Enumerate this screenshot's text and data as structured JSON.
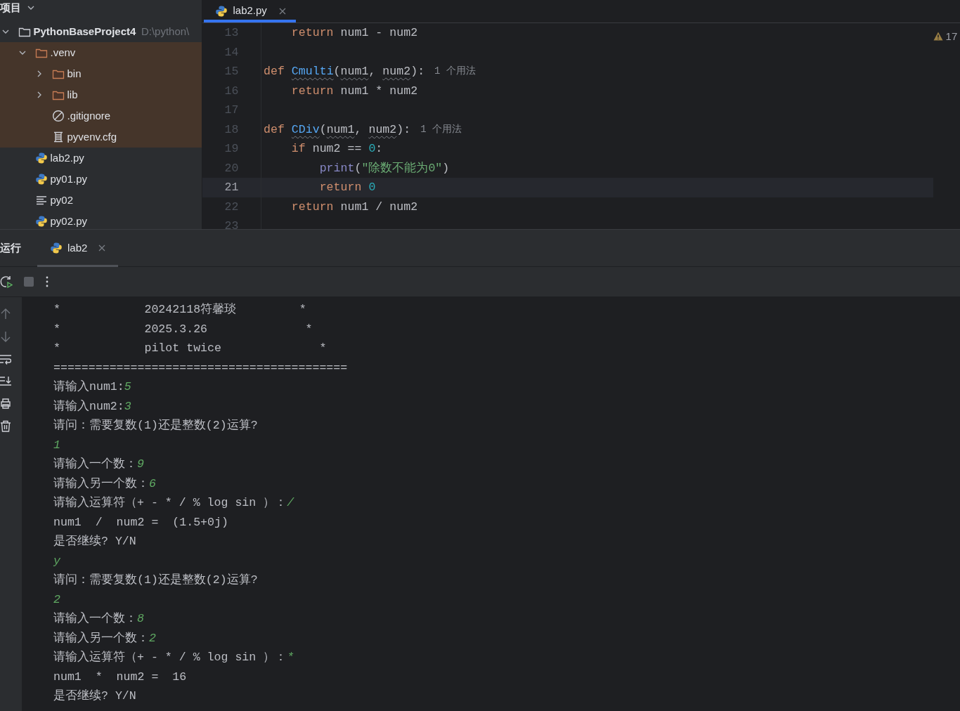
{
  "project_panel": {
    "title": "项目",
    "tree": [
      {
        "label": "PythonBaseProject4",
        "path": "D:\\python\\",
        "kind": "folder",
        "bold": true,
        "expanded": true,
        "children": [
          {
            "label": ".venv",
            "kind": "folder",
            "expanded": true,
            "excluded": true,
            "children": [
              {
                "label": "bin",
                "kind": "folder",
                "expanded": false
              },
              {
                "label": "lib",
                "kind": "folder",
                "expanded": false
              },
              {
                "label": ".gitignore",
                "kind": "ignore"
              },
              {
                "label": "pyvenv.cfg",
                "kind": "config"
              }
            ]
          },
          {
            "label": "lab2.py",
            "kind": "python"
          },
          {
            "label": "py01.py",
            "kind": "python"
          },
          {
            "label": "py02",
            "kind": "text"
          },
          {
            "label": "py02.py",
            "kind": "python"
          }
        ]
      }
    ]
  },
  "editor": {
    "tabs": [
      {
        "label": "lab2.py",
        "selected": true
      }
    ],
    "warnings": "17",
    "lines": [
      {
        "no": "13",
        "current": false,
        "tokens": [
          {
            "t": "    return",
            "kind": "keyword"
          },
          {
            "t": " num1 - num2",
            "kind": "plain"
          }
        ]
      },
      {
        "no": "14",
        "current": false
      },
      {
        "no": "15",
        "current": false,
        "tokens": [
          {
            "t": "def ",
            "kind": "keyword"
          },
          {
            "t": "Cmulti",
            "kind": "function",
            "squiggle": true
          },
          {
            "t": "(",
            "kind": "plain"
          },
          {
            "t": "num1",
            "kind": "plain",
            "squiggle": true
          },
          {
            "t": ", ",
            "kind": "plain"
          },
          {
            "t": "num2",
            "kind": "plain",
            "squiggle": true
          },
          {
            "t": "):",
            "kind": "plain"
          }
        ],
        "hint": "1 个用法"
      },
      {
        "no": "16",
        "current": false,
        "tokens": [
          {
            "t": "    return",
            "kind": "keyword"
          },
          {
            "t": " num1 * num2",
            "kind": "plain"
          }
        ]
      },
      {
        "no": "17",
        "current": false
      },
      {
        "no": "18",
        "current": false,
        "tokens": [
          {
            "t": "def ",
            "kind": "keyword"
          },
          {
            "t": "CDiv",
            "kind": "function",
            "squiggle": true
          },
          {
            "t": "(",
            "kind": "plain"
          },
          {
            "t": "num1",
            "kind": "plain",
            "squiggle": true
          },
          {
            "t": ", ",
            "kind": "plain"
          },
          {
            "t": "num2",
            "kind": "plain",
            "squiggle": true
          },
          {
            "t": "):",
            "kind": "plain"
          }
        ],
        "hint": "1 个用法"
      },
      {
        "no": "19",
        "current": false,
        "tokens": [
          {
            "t": "    if",
            "kind": "keyword"
          },
          {
            "t": " num2 == ",
            "kind": "plain"
          },
          {
            "t": "0",
            "kind": "number"
          },
          {
            "t": ":",
            "kind": "plain"
          }
        ]
      },
      {
        "no": "20",
        "current": false,
        "tokens": [
          {
            "t": "        print",
            "kind": "builtin"
          },
          {
            "t": "(",
            "kind": "plain"
          },
          {
            "t": "\"除数不能为0\"",
            "kind": "string"
          },
          {
            "t": ")",
            "kind": "plain"
          }
        ]
      },
      {
        "no": "21",
        "current": true,
        "tokens": [
          {
            "t": "        return ",
            "kind": "keyword"
          },
          {
            "t": "0",
            "kind": "number"
          }
        ]
      },
      {
        "no": "22",
        "current": false,
        "tokens": [
          {
            "t": "    return",
            "kind": "keyword"
          },
          {
            "t": " num1 / num2",
            "kind": "plain"
          }
        ]
      },
      {
        "no": "23",
        "current": false
      }
    ]
  },
  "run_panel": {
    "title": "运行",
    "tabs": [
      {
        "label": "lab2",
        "selected": true
      }
    ],
    "console": [
      [
        {
          "t": "*            20242118符馨琰         *",
          "input": false
        }
      ],
      [
        {
          "t": "*            2025.3.26              *",
          "input": false
        }
      ],
      [
        {
          "t": "*            pilot twice              *",
          "input": false
        }
      ],
      [
        {
          "t": "==========================================",
          "input": false
        }
      ],
      [
        {
          "t": "请输入num1:",
          "input": false
        },
        {
          "t": "5",
          "input": true
        }
      ],
      [
        {
          "t": "请输入num2:",
          "input": false
        },
        {
          "t": "3",
          "input": true
        }
      ],
      [
        {
          "t": "请问：需要复数(1)还是整数(2)运算?",
          "input": false
        }
      ],
      [
        {
          "t": "1",
          "input": true
        }
      ],
      [
        {
          "t": "请输入一个数：",
          "input": false
        },
        {
          "t": "9",
          "input": true
        }
      ],
      [
        {
          "t": "请输入另一个数：",
          "input": false
        },
        {
          "t": "6",
          "input": true
        }
      ],
      [
        {
          "t": "请输入运算符（+ - * / % log sin ）：",
          "input": false
        },
        {
          "t": "/",
          "input": true
        }
      ],
      [
        {
          "t": "num1  /  num2 =  (1.5+0j)",
          "input": false
        }
      ],
      [
        {
          "t": "是否继续? Y/N",
          "input": false
        }
      ],
      [
        {
          "t": "y",
          "input": true
        }
      ],
      [
        {
          "t": "请问：需要复数(1)还是整数(2)运算?",
          "input": false
        }
      ],
      [
        {
          "t": "2",
          "input": true
        }
      ],
      [
        {
          "t": "请输入一个数：",
          "input": false
        },
        {
          "t": "8",
          "input": true
        }
      ],
      [
        {
          "t": "请输入另一个数：",
          "input": false
        },
        {
          "t": "2",
          "input": true
        }
      ],
      [
        {
          "t": "请输入运算符（+ - * / % log sin ）：",
          "input": false
        },
        {
          "t": "*",
          "input": true
        }
      ],
      [
        {
          "t": "num1  *  num2 =  16",
          "input": false
        }
      ],
      [
        {
          "t": "是否继续? Y/N",
          "input": false
        }
      ]
    ]
  }
}
